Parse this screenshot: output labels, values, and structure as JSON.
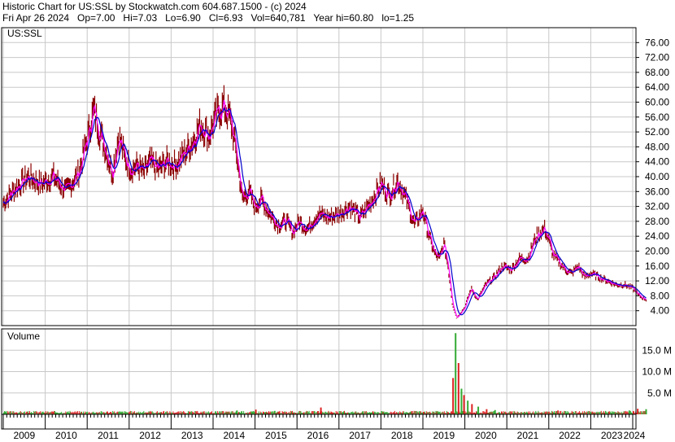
{
  "header": {
    "line1": "Historic Chart for US:SSL by Stockwatch.com 604.687.1500 - (c) 2024",
    "line2": "Fri Apr 26 2024   Op=7.00   Hi=7.03   Lo=6.90   Cl=6.93   Vol=640,781   Year hi=60.80   lo=1.25"
  },
  "chart_data": [
    {
      "type": "line",
      "symbol": "US:SSL",
      "ylim": [
        0,
        80
      ],
      "yticks": [
        "4.00",
        "8.00",
        "12.00",
        "16.00",
        "20.00",
        "24.00",
        "28.00",
        "32.00",
        "36.00",
        "40.00",
        "44.00",
        "48.00",
        "52.00",
        "56.00",
        "60.00",
        "64.00",
        "68.00",
        "72.00",
        "76.00"
      ],
      "x": [
        2009.0,
        2009.3,
        2009.6,
        2009.9,
        2010.2,
        2010.5,
        2010.8,
        2011.0,
        2011.15,
        2011.3,
        2011.45,
        2011.6,
        2011.75,
        2011.9,
        2012.05,
        2012.2,
        2012.35,
        2012.5,
        2012.7,
        2012.9,
        2013.1,
        2013.3,
        2013.5,
        2013.7,
        2013.9,
        2014.1,
        2014.25,
        2014.4,
        2014.55,
        2014.7,
        2014.85,
        2015.0,
        2015.15,
        2015.35,
        2015.55,
        2015.75,
        2015.9,
        2016.05,
        2016.25,
        2016.5,
        2016.75,
        2017.0,
        2017.25,
        2017.5,
        2017.75,
        2018.0,
        2018.2,
        2018.4,
        2018.6,
        2018.8,
        2019.0,
        2019.1,
        2019.2,
        2019.3,
        2019.4,
        2019.5,
        2019.6,
        2019.7,
        2019.8,
        2020.0,
        2020.15,
        2020.3,
        2020.5,
        2020.7,
        2020.9,
        2021.1,
        2021.3,
        2021.5,
        2021.7,
        2021.9,
        2022.0,
        2022.1,
        2022.25,
        2022.4,
        2022.55,
        2022.7,
        2022.85,
        2023.0,
        2023.2,
        2023.4,
        2023.6,
        2023.8,
        2024.0,
        2024.15,
        2024.32
      ],
      "series": [
        {
          "values": [
            33,
            37,
            40,
            38,
            40,
            36,
            41,
            50,
            58,
            52,
            47,
            41,
            51,
            45,
            42,
            43,
            41,
            44,
            42,
            44,
            43,
            46,
            49,
            54,
            51,
            57,
            59,
            56,
            47,
            34,
            36,
            32,
            34,
            30,
            27,
            28,
            25,
            28,
            26,
            30,
            29,
            30,
            32,
            29,
            33,
            38,
            35,
            39,
            34,
            27,
            31,
            26,
            22,
            19,
            18,
            22,
            16,
            6,
            2,
            5,
            10,
            7,
            11,
            13,
            16,
            15,
            18,
            18,
            24,
            26,
            23,
            19,
            17,
            15,
            14,
            16,
            13,
            14,
            13,
            12,
            11,
            11,
            10,
            8,
            7
          ]
        }
      ]
    },
    {
      "type": "bar",
      "title": "Volume",
      "ylim": [
        0,
        20
      ],
      "yticks": [
        "5.0 M",
        "10.0 M",
        "15.0 M"
      ],
      "xtick_labels": [
        "2009",
        "2010",
        "2011",
        "2012",
        "2013",
        "2014",
        "2015",
        "2016",
        "2017",
        "2018",
        "2019",
        "2020",
        "2021",
        "2022",
        "2023",
        "2024"
      ],
      "spikes": [
        {
          "x": 2014.55,
          "value": 0.9
        },
        {
          "x": 2015.0,
          "value": 1.1
        },
        {
          "x": 2015.45,
          "value": 0.8
        },
        {
          "x": 2016.55,
          "value": 1.6
        },
        {
          "x": 2017.55,
          "value": 0.7
        },
        {
          "x": 2019.7,
          "value": 8.5
        },
        {
          "x": 2019.76,
          "value": 19.0
        },
        {
          "x": 2019.83,
          "value": 12.0
        },
        {
          "x": 2019.9,
          "value": 6.0
        },
        {
          "x": 2019.96,
          "value": 4.5
        },
        {
          "x": 2020.05,
          "value": 3.2
        },
        {
          "x": 2020.15,
          "value": 2.4
        },
        {
          "x": 2020.3,
          "value": 1.8
        },
        {
          "x": 2020.5,
          "value": 1.2
        },
        {
          "x": 2020.7,
          "value": 1.0
        },
        {
          "x": 2022.2,
          "value": 0.9
        },
        {
          "x": 2023.9,
          "value": 0.9
        },
        {
          "x": 2024.1,
          "value": 1.3
        },
        {
          "x": 2024.3,
          "value": 1.2
        }
      ]
    }
  ],
  "colors": {
    "price": "#8b0000",
    "short_ma": "#ff00ff",
    "long_ma": "#0000cc",
    "vol_up": "#33aa33",
    "vol_down": "#dd2222",
    "grid": "#c8c8c8"
  }
}
